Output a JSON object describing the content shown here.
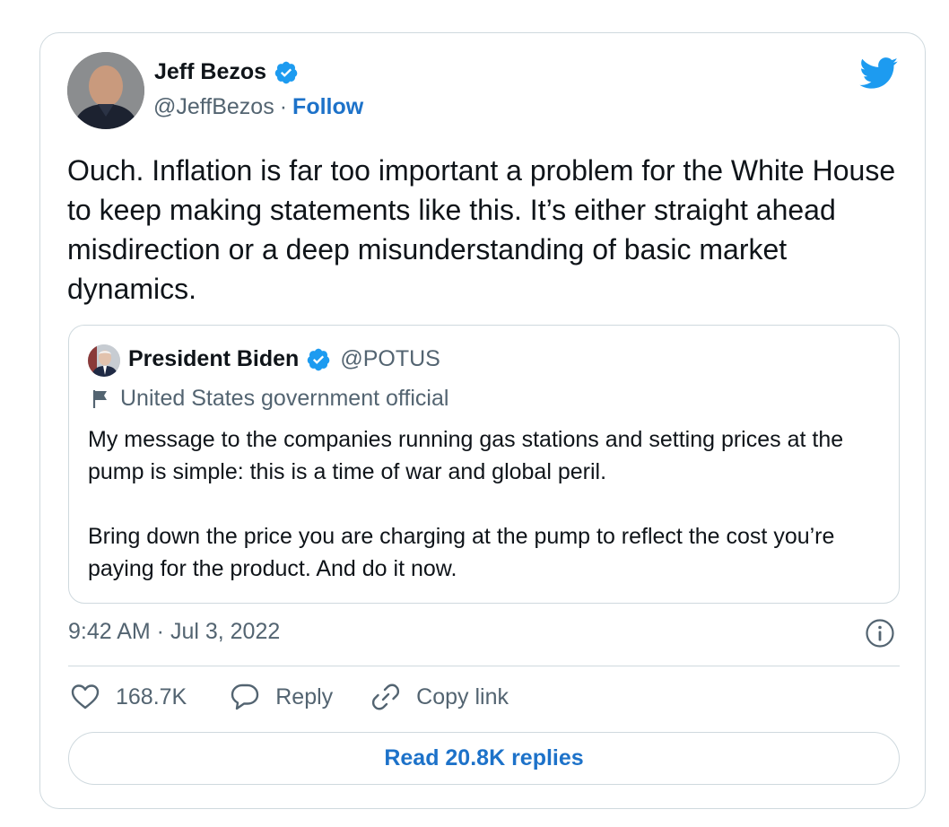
{
  "author": {
    "name": "Jeff Bezos",
    "handle": "@JeffBezos",
    "separator": "·",
    "follow_label": "Follow"
  },
  "tweet": {
    "text": "Ouch. Inflation is far too important a problem for the White House to keep making statements like this. It’s either straight ahead misdirection or a deep misunderstanding of basic market dynamics."
  },
  "quoted": {
    "name": "President Biden",
    "handle": "@POTUS",
    "label": "United States government official",
    "text": "My message to the companies running gas stations and setting prices at the pump is simple: this is a time of war and global peril.\n\nBring down the price you are charging at the pump to reflect the cost you’re paying for the product. And do it now."
  },
  "meta": {
    "timestamp": "9:42 AM · Jul 3, 2022"
  },
  "actions": {
    "likes": "168.7K",
    "reply_label": "Reply",
    "copy_link_label": "Copy link"
  },
  "read_replies_label": "Read 20.8K replies",
  "colors": {
    "brand": "#1d9bf0",
    "link": "#1d72c9",
    "secondary_text": "#536471",
    "border": "#cfd9de"
  },
  "icons": [
    "verified-badge-icon",
    "twitter-bird-icon",
    "flag-icon",
    "info-icon",
    "heart-icon",
    "speech-bubble-icon",
    "link-icon"
  ]
}
